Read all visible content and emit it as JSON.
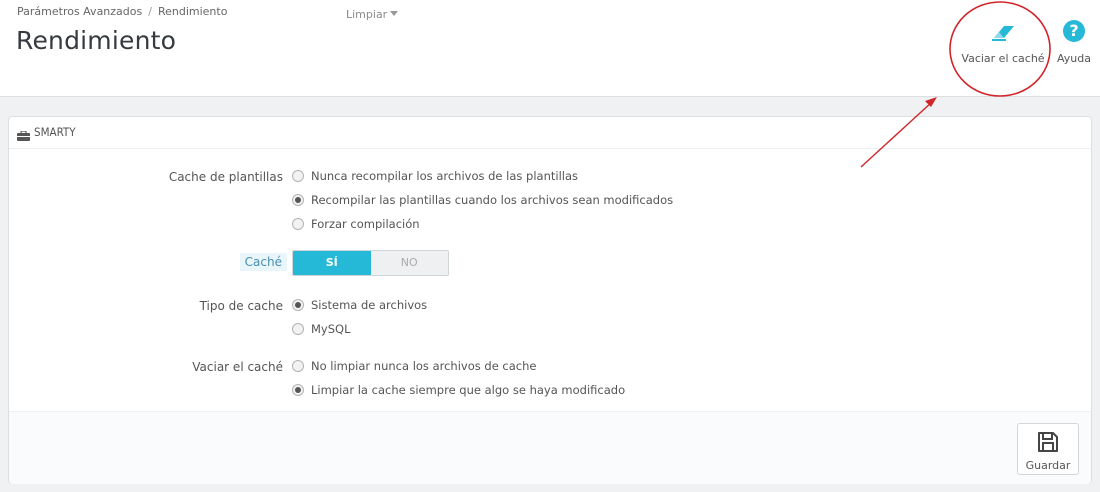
{
  "header": {
    "breadcrumb": [
      "Parámetros Avanzados",
      "Rendimiento"
    ],
    "breadcrumb_sep": "/",
    "title": "Rendimiento",
    "filter_label": "Limpiar",
    "toolbar": {
      "clear_cache_label": "Vaciar el caché",
      "clear_cache_icon": "eraser-icon",
      "help_label": "Ayuda",
      "help_icon": "question-circle-icon",
      "help_glyph": "?"
    }
  },
  "panel": {
    "heading": "SMARTY",
    "heading_icon": "briefcase-icon",
    "fields": {
      "template_cache": {
        "label": "Cache de plantillas",
        "options": [
          "Nunca recompilar los archivos de las plantillas",
          "Recompilar las plantillas cuando los archivos sean modificados",
          "Forzar compilación"
        ],
        "selected_index": 1
      },
      "cache": {
        "label": "Caché",
        "on_label": "SÍ",
        "off_label": "NO",
        "value": "SÍ"
      },
      "cache_type": {
        "label": "Tipo de cache",
        "options": [
          "Sistema de archivos",
          "MySQL"
        ],
        "selected_index": 0
      },
      "clear_cache": {
        "label": "Vaciar el caché",
        "options": [
          "No limpiar nunca los archivos de cache",
          "Limpiar la cache siempre que algo se haya modificado"
        ],
        "selected_index": 1
      }
    },
    "footer": {
      "save_label": "Guardar",
      "save_icon": "floppy-disk-icon"
    }
  },
  "colors": {
    "accent": "#25b9d7",
    "annotation_red": "#d0262b",
    "page_bg": "#eff1f2"
  }
}
